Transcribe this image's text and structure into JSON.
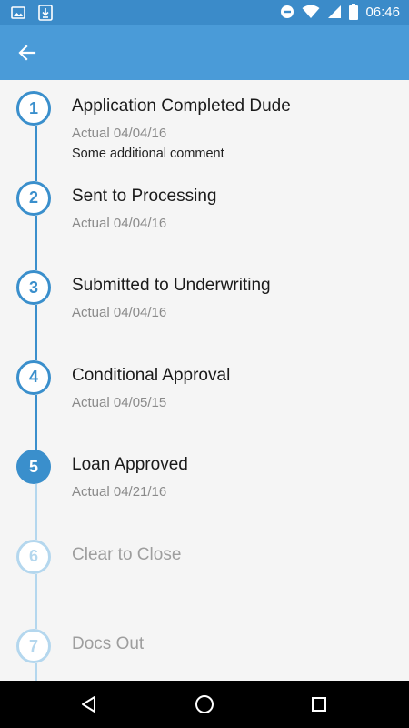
{
  "status_bar": {
    "time": "06:46",
    "left_icons": [
      "image-icon",
      "download-icon"
    ],
    "right_icons": [
      "do-not-disturb-icon",
      "wifi-icon",
      "cell-signal-icon",
      "battery-icon"
    ]
  },
  "app_bar": {
    "back_icon": "arrow-back-icon"
  },
  "colors": {
    "status_bar": "#3b8bc9",
    "app_bar": "#4a9bd8",
    "accent": "#3a8fcc",
    "pending": "#b4d7ee"
  },
  "steps": [
    {
      "number": "1",
      "title": "Application Completed Dude",
      "date": "Actual 04/04/16",
      "comment": "Some additional comment",
      "state": "done"
    },
    {
      "number": "2",
      "title": "Sent to Processing",
      "date": "Actual 04/04/16",
      "comment": "",
      "state": "done"
    },
    {
      "number": "3",
      "title": "Submitted to Underwriting",
      "date": "Actual 04/04/16",
      "comment": "",
      "state": "done"
    },
    {
      "number": "4",
      "title": "Conditional Approval",
      "date": "Actual 04/05/15",
      "comment": "",
      "state": "done"
    },
    {
      "number": "5",
      "title": "Loan Approved",
      "date": "Actual 04/21/16",
      "comment": "",
      "state": "current"
    },
    {
      "number": "6",
      "title": "Clear to Close",
      "date": "",
      "comment": "",
      "state": "pending"
    },
    {
      "number": "7",
      "title": "Docs Out",
      "date": "",
      "comment": "",
      "state": "pending"
    }
  ],
  "nav_bar": {
    "buttons": [
      "back-triangle-icon",
      "home-circle-icon",
      "recents-square-icon"
    ]
  }
}
